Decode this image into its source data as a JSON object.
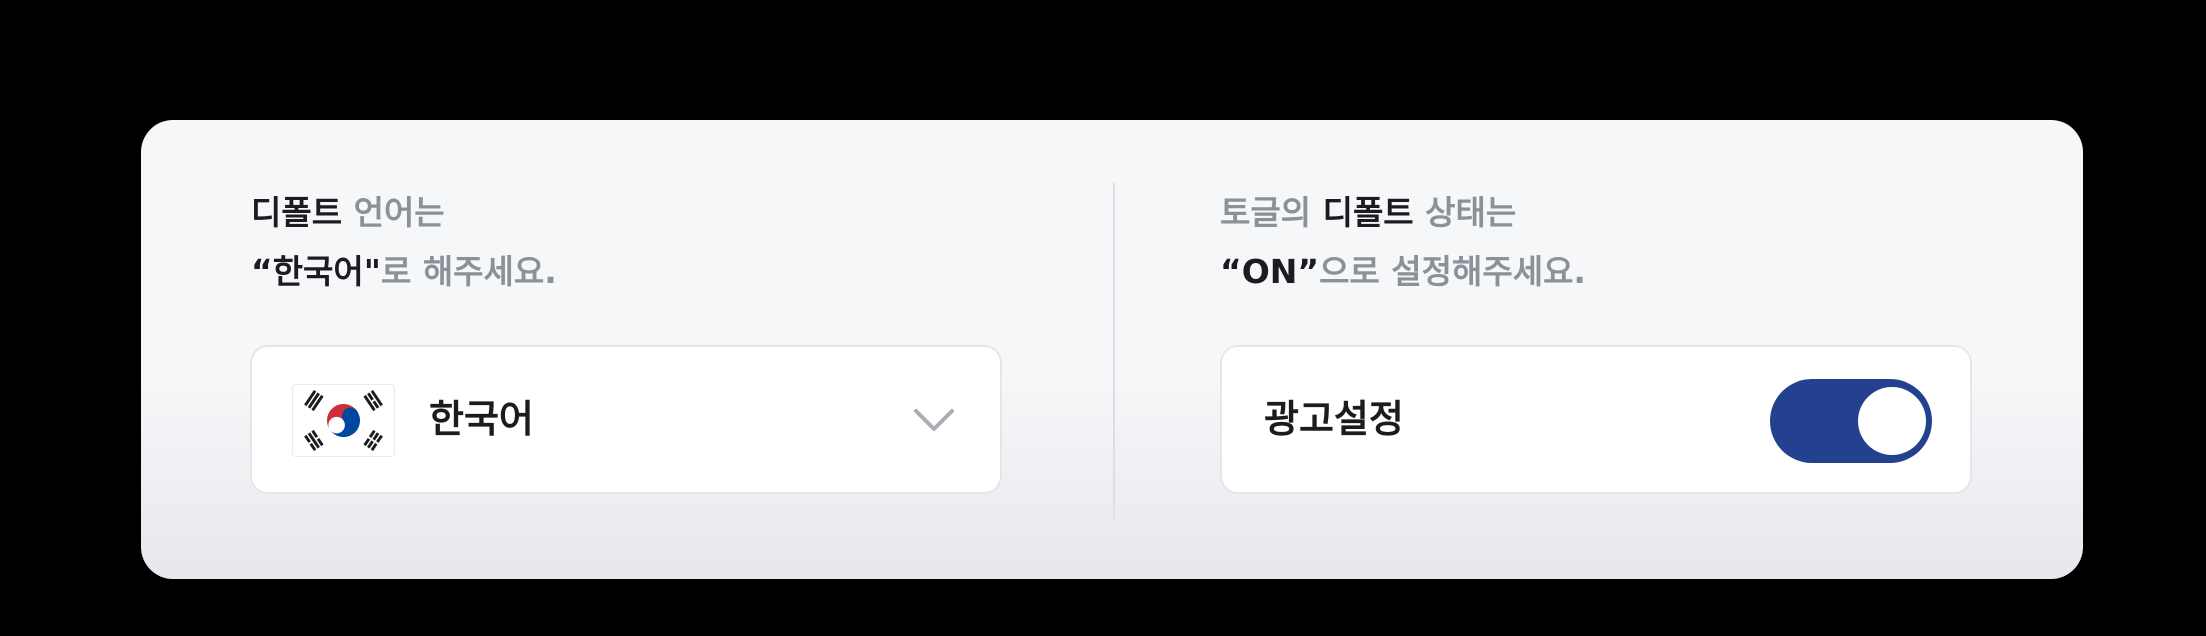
{
  "left": {
    "heading": {
      "line1_strong": "디폴트",
      "line1_rest": " 언어는",
      "line2_strong": "“한국어\"",
      "line2_rest": "로 해주세요."
    },
    "dropdown": {
      "flag_icon": "korea-flag-icon",
      "value": "한국어",
      "chevron_icon": "chevron-down-icon"
    }
  },
  "right": {
    "heading": {
      "line1_pre": "토글의 ",
      "line1_strong": "디폴트",
      "line1_post": " 상태는",
      "line2_strong": "“ON”",
      "line2_rest": "으로 설정해주세요."
    },
    "setting": {
      "label": "광고설정",
      "toggle_state": "on"
    }
  },
  "colors": {
    "card_background": "#f6f7f9",
    "heading_muted": "#8b9099",
    "heading_strong": "#1b1c1f",
    "toggle_on": "#23418f"
  }
}
